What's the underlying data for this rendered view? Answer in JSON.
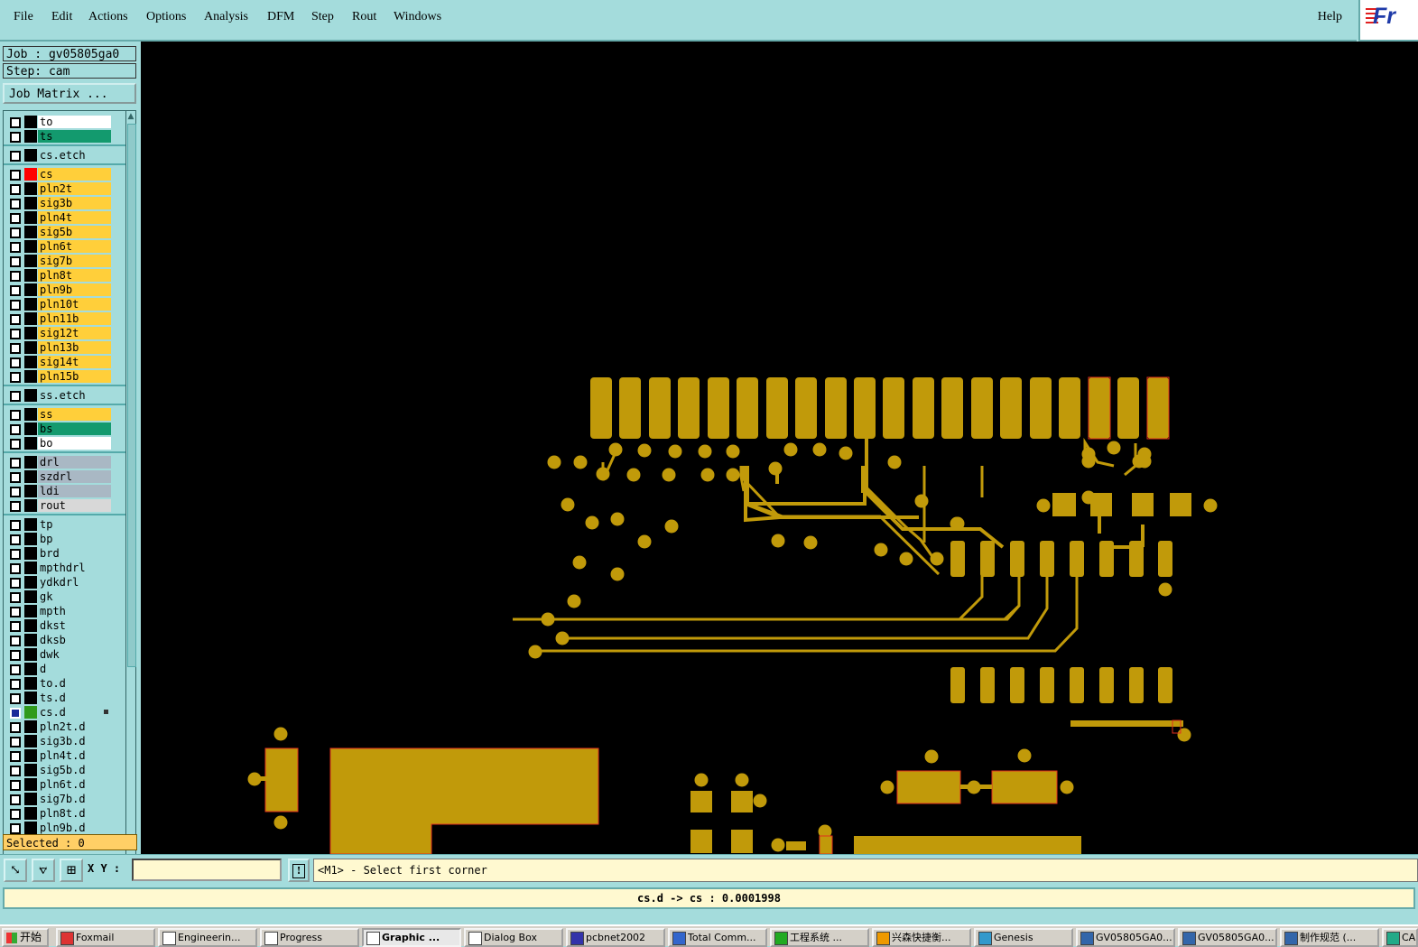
{
  "menu": {
    "items": [
      "File",
      "Edit",
      "Actions",
      "Options",
      "Analysis",
      "DFM",
      "Step",
      "Rout",
      "Windows"
    ],
    "help": "Help"
  },
  "logo_text": "Fr",
  "job": {
    "job_line": "Job : gv05805ga0",
    "step_line": "Step: cam",
    "matrix_button": "Job Matrix ..."
  },
  "layers": [
    {
      "name": "to",
      "bg": "#ffffff"
    },
    {
      "name": "ts",
      "bg": "#139a6e"
    },
    {
      "name": "cs.etch",
      "bg": "#a4dcdc",
      "sep": true
    },
    {
      "name": "cs",
      "bg": "#ffcf3a",
      "sep": true,
      "swatch": "#ff0000"
    },
    {
      "name": "pln2t",
      "bg": "#ffcf3a"
    },
    {
      "name": "sig3b",
      "bg": "#ffcf3a"
    },
    {
      "name": "pln4t",
      "bg": "#ffcf3a"
    },
    {
      "name": "sig5b",
      "bg": "#ffcf3a"
    },
    {
      "name": "pln6t",
      "bg": "#ffcf3a"
    },
    {
      "name": "sig7b",
      "bg": "#ffcf3a"
    },
    {
      "name": "pln8t",
      "bg": "#ffcf3a"
    },
    {
      "name": "pln9b",
      "bg": "#ffcf3a"
    },
    {
      "name": "pln10t",
      "bg": "#ffcf3a"
    },
    {
      "name": "pln11b",
      "bg": "#ffcf3a"
    },
    {
      "name": "sig12t",
      "bg": "#ffcf3a"
    },
    {
      "name": "pln13b",
      "bg": "#ffcf3a"
    },
    {
      "name": "sig14t",
      "bg": "#ffcf3a"
    },
    {
      "name": "pln15b",
      "bg": "#ffcf3a"
    },
    {
      "name": "ss.etch",
      "bg": "#a4dcdc",
      "sep": true
    },
    {
      "name": "ss",
      "bg": "#ffcf3a",
      "sep": true
    },
    {
      "name": "bs",
      "bg": "#139a6e"
    },
    {
      "name": "bo",
      "bg": "#ffffff"
    },
    {
      "name": "drl",
      "bg": "#a9b8c4",
      "sep": true
    },
    {
      "name": "szdrl",
      "bg": "#a9b8c4"
    },
    {
      "name": "ldi",
      "bg": "#a9b8c4"
    },
    {
      "name": "rout",
      "bg": "#d8d8d8"
    },
    {
      "name": "tp",
      "bg": "#a4dcdc",
      "sep": true
    },
    {
      "name": "bp",
      "bg": "#a4dcdc"
    },
    {
      "name": "brd",
      "bg": "#a4dcdc"
    },
    {
      "name": "mpthdrl",
      "bg": "#a4dcdc"
    },
    {
      "name": "ydkdrl",
      "bg": "#a4dcdc"
    },
    {
      "name": "gk",
      "bg": "#a4dcdc"
    },
    {
      "name": "mpth",
      "bg": "#a4dcdc"
    },
    {
      "name": "dkst",
      "bg": "#a4dcdc"
    },
    {
      "name": "dksb",
      "bg": "#a4dcdc"
    },
    {
      "name": "dwk",
      "bg": "#a4dcdc"
    },
    {
      "name": "d",
      "bg": "#a4dcdc"
    },
    {
      "name": "to.d",
      "bg": "#a4dcdc"
    },
    {
      "name": "ts.d",
      "bg": "#a4dcdc"
    },
    {
      "name": "cs.d",
      "bg": "#a4dcdc",
      "swatch": "#2f9a1c",
      "checkbox": "#1a2a9a",
      "marker": true
    },
    {
      "name": "pln2t.d",
      "bg": "#a4dcdc"
    },
    {
      "name": "sig3b.d",
      "bg": "#a4dcdc"
    },
    {
      "name": "pln4t.d",
      "bg": "#a4dcdc"
    },
    {
      "name": "sig5b.d",
      "bg": "#a4dcdc"
    },
    {
      "name": "pln6t.d",
      "bg": "#a4dcdc"
    },
    {
      "name": "sig7b.d",
      "bg": "#a4dcdc"
    },
    {
      "name": "pln8t.d",
      "bg": "#a4dcdc"
    },
    {
      "name": "pln9b.d",
      "bg": "#a4dcdc"
    }
  ],
  "selected": "Selected : 0",
  "cmd": {
    "xy_label": "X Y :",
    "xy_value": "",
    "warn_glyph": "!",
    "prompt": "<M1> - Select first corner"
  },
  "status": "cs.d -> cs : 0.0001998",
  "colors": {
    "copper": "#c19a0a",
    "canvas": "#000000",
    "panel": "#a4dcdc",
    "outline": "#e0301e"
  },
  "taskbar": {
    "start": "开始",
    "tasks": [
      {
        "label": "Foxmail",
        "icon": "foxmail-icon"
      },
      {
        "label": "Engineerin...",
        "icon": "x-window-icon"
      },
      {
        "label": "Progress",
        "icon": "x-window-icon"
      },
      {
        "label": "Graphic ...",
        "icon": "x-window-icon",
        "active": true
      },
      {
        "label": "Dialog Box",
        "icon": "x-window-icon"
      },
      {
        "label": "pcbnet2002",
        "icon": "globe-icon"
      },
      {
        "label": "Total Comm...",
        "icon": "disk-icon"
      },
      {
        "label": "工程系统 ...",
        "icon": "p-app-icon"
      },
      {
        "label": "兴森快捷衡...",
        "icon": "star-icon"
      },
      {
        "label": "Genesis",
        "icon": "genesis-icon"
      },
      {
        "label": "GV05805GA0...",
        "icon": "doc-icon"
      },
      {
        "label": "GV05805GA0...",
        "icon": "doc-icon"
      },
      {
        "label": "制作规范 (...",
        "icon": "doc-icon"
      },
      {
        "label": "CAM",
        "icon": "cam-icon"
      }
    ]
  }
}
